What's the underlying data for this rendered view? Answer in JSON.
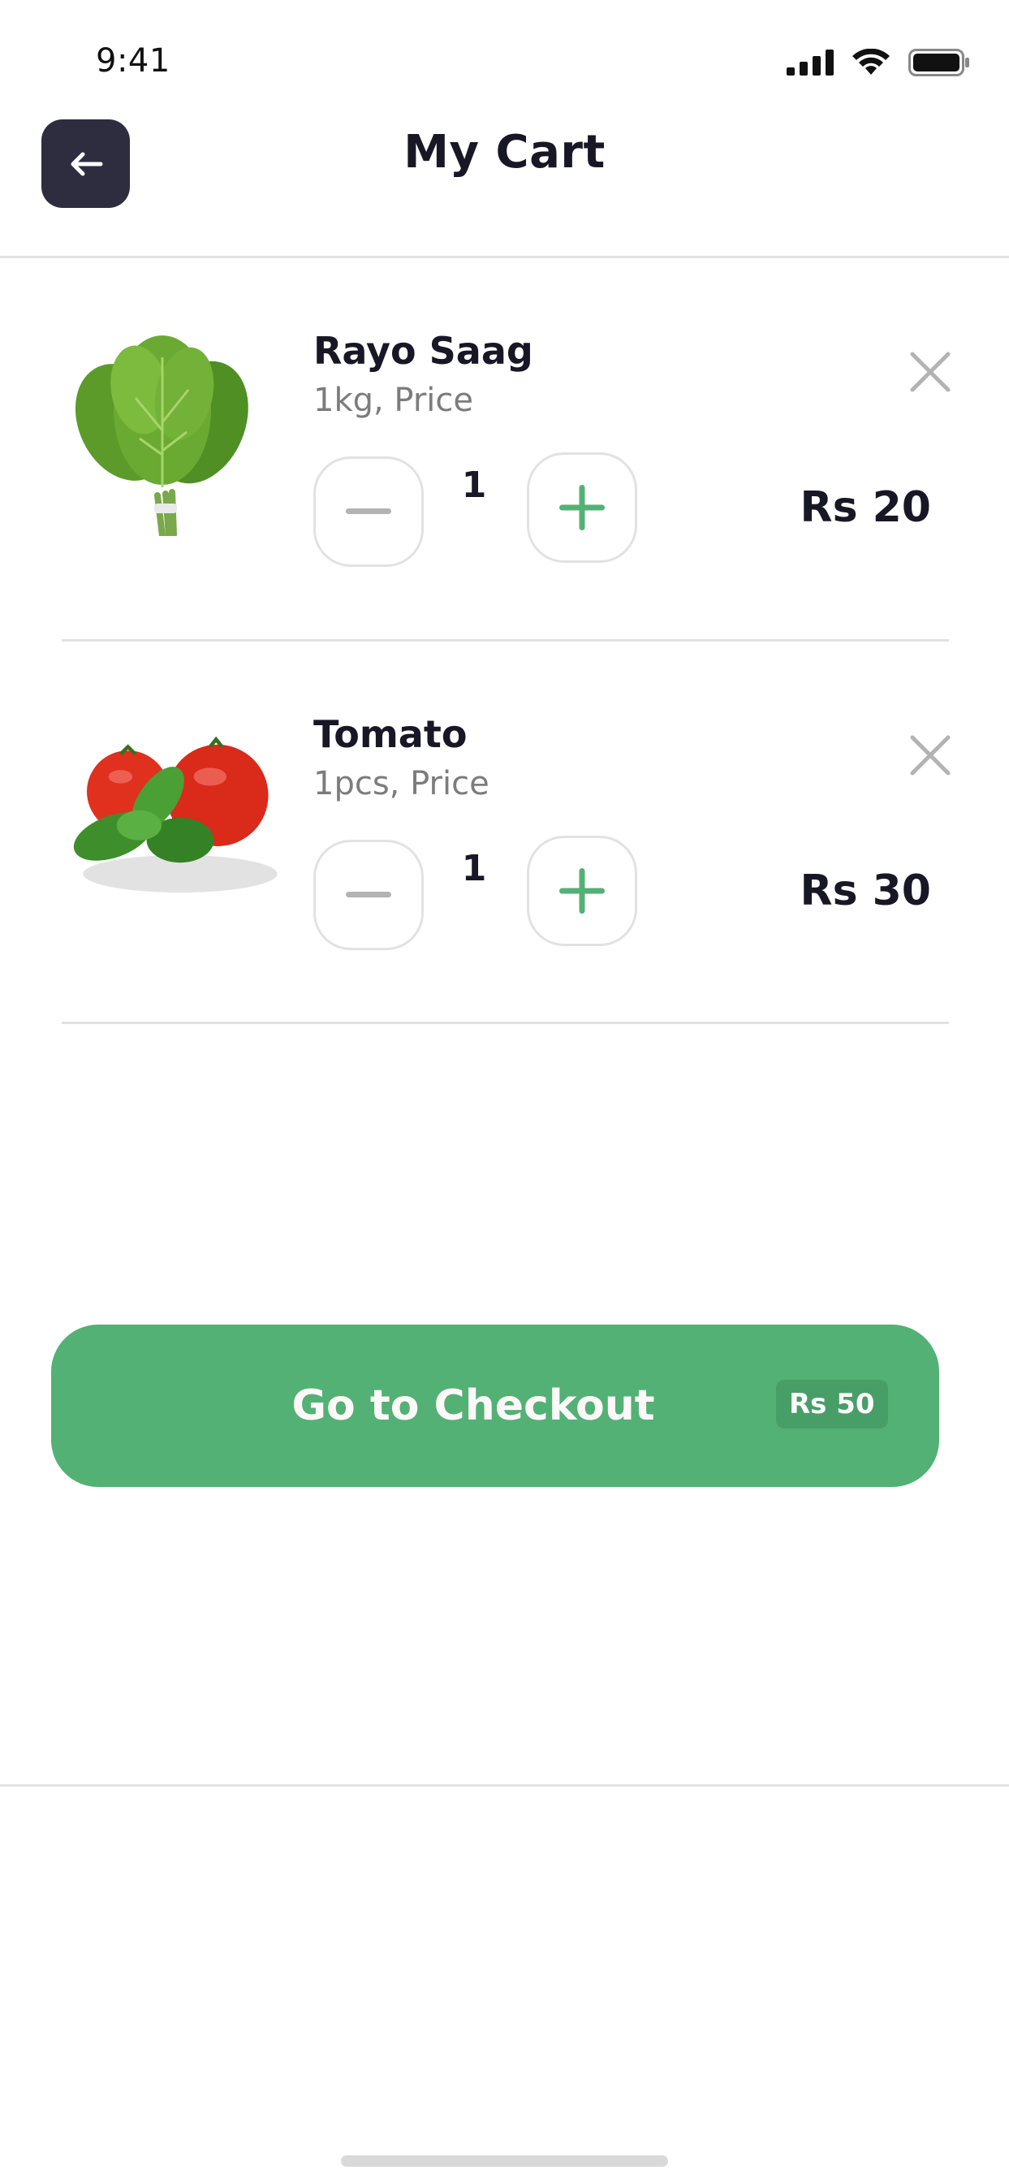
{
  "status_bar": {
    "time": "9:41"
  },
  "header": {
    "title": "My Cart"
  },
  "cart_items": [
    {
      "name": "Rayo Saag",
      "subtitle": "1kg, Price",
      "quantity": "1",
      "price": "Rs 20",
      "image": "leafy-greens-bunch"
    },
    {
      "name": "Tomato",
      "subtitle": "1pcs, Price",
      "quantity": "1",
      "price": "Rs 30",
      "image": "tomatoes-with-basil"
    }
  ],
  "checkout": {
    "label": "Go to Checkout",
    "total": "Rs 50"
  },
  "colors": {
    "primary_green": "#53b175",
    "dark_button": "#2d2d3f",
    "text_dark": "#181725",
    "text_muted": "#7c7c7c",
    "divider": "#e2e2e2"
  }
}
